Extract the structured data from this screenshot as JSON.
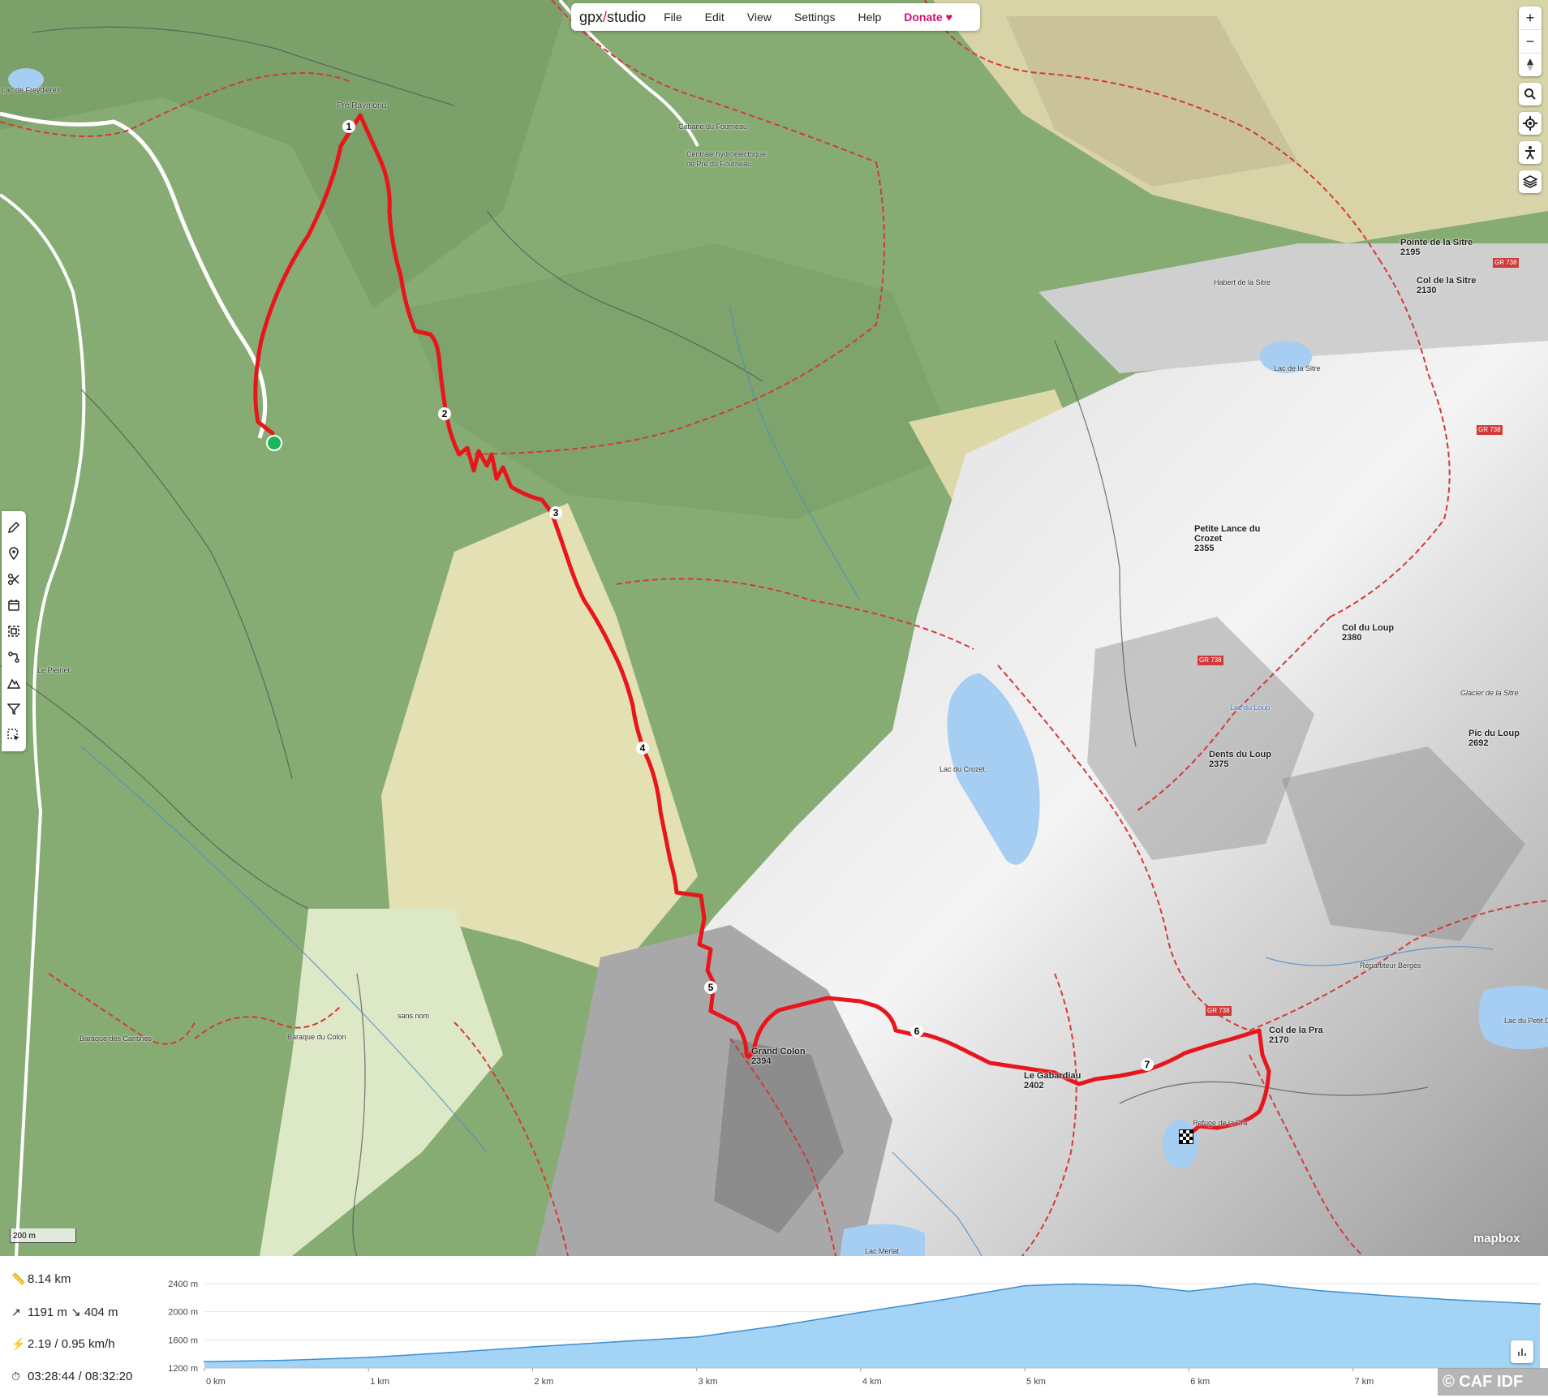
{
  "app": {
    "logo": "gpx",
    "logo_suffix": "studio",
    "menu": [
      "File",
      "Edit",
      "View",
      "Settings",
      "Help"
    ],
    "donate": "Donate",
    "accent": "#d0116f",
    "track_color": "#e8161b"
  },
  "map": {
    "route_markers": [
      "1",
      "2",
      "3",
      "4",
      "5",
      "6",
      "7"
    ],
    "labels": {
      "lac_freydieres": "Lac de Freydières",
      "pre_raymond": "Pré Raymond",
      "cabane_fourneau": "Cabane du Fourneau",
      "centrale": "Centrale hydroélectrique de Pré du Fourneau",
      "pointe_sitre": "Pointe de la Sitre",
      "pointe_sitre_alt": "2195",
      "col_sitre": "Col de la Sitre",
      "col_sitre_alt": "2130",
      "habert_sitre": "Habert de la Sitre",
      "lac_sitre": "Lac de la Sitre",
      "petite_lance": "Petite Lance du Crozet",
      "petite_lance_alt": "2355",
      "col_loup": "Col du Loup",
      "col_loup_alt": "2380",
      "lac_loup": "Lac du Loup",
      "glacier_sitre": "Glacier de la Sitre",
      "pic_loup": "Pic du Loup",
      "pic_loup_alt": "2692",
      "dents_loup": "Dents du Loup",
      "dents_loup_alt": "2375",
      "lac_crozet": "Lac du Crozet",
      "le_pleinet": "Le Pleinet",
      "grand_colon": "Grand Colon",
      "grand_colon_alt": "2394",
      "le_gabardiau": "Le Gabardiau",
      "le_gabardiau_alt": "2402",
      "col_pra": "Col de la Pra",
      "col_pra_alt": "2170",
      "repartiteur": "Répartiteur Bergès",
      "lac_petit_doménon": "Lac du Petit Dom",
      "baraque_colon": "Baraque du Colon",
      "baraque_cantines": "Baraque des Cantines",
      "sans_nom": "sans nom",
      "lac_merlat": "Lac Merlat",
      "refuge": "Refuge de la Pra",
      "gr738": "GR 738"
    },
    "scale": "200 m",
    "attribution": "mapbox"
  },
  "controls": {
    "right": [
      "zoom-in",
      "zoom-out",
      "compass",
      "search",
      "locate",
      "street-view",
      "layers"
    ]
  },
  "stats": {
    "distance": "8.14 km",
    "elevation_gain": "1191 m",
    "elevation_loss": "404 m",
    "speed": "2.19 / 0.95 km/h",
    "time": "03:28:44 / 08:32:20"
  },
  "chart_data": {
    "type": "area",
    "title": "",
    "xlabel": "",
    "ylabel": "",
    "y_tick_labels": [
      "2400 m",
      "2000 m",
      "1600 m",
      "1200 m"
    ],
    "x_tick_labels": [
      "0 km",
      "1 km",
      "2 km",
      "3 km",
      "4 km",
      "5 km",
      "6 km",
      "7 km"
    ],
    "ylim": [
      1200,
      2400
    ],
    "xlim": [
      0,
      8.14
    ],
    "x": [
      0,
      0.5,
      1,
      1.5,
      2,
      2.5,
      3,
      3.5,
      4,
      4.5,
      5,
      5.3,
      5.7,
      6,
      6.4,
      6.8,
      7.2,
      7.6,
      8.14
    ],
    "y": [
      1290,
      1310,
      1350,
      1420,
      1500,
      1570,
      1640,
      1800,
      1990,
      2170,
      2370,
      2394,
      2370,
      2290,
      2400,
      2300,
      2230,
      2170,
      2110
    ],
    "fill": "#a4d4f5",
    "line": "#3d8fd1"
  },
  "watermark": "© CAF IDF"
}
